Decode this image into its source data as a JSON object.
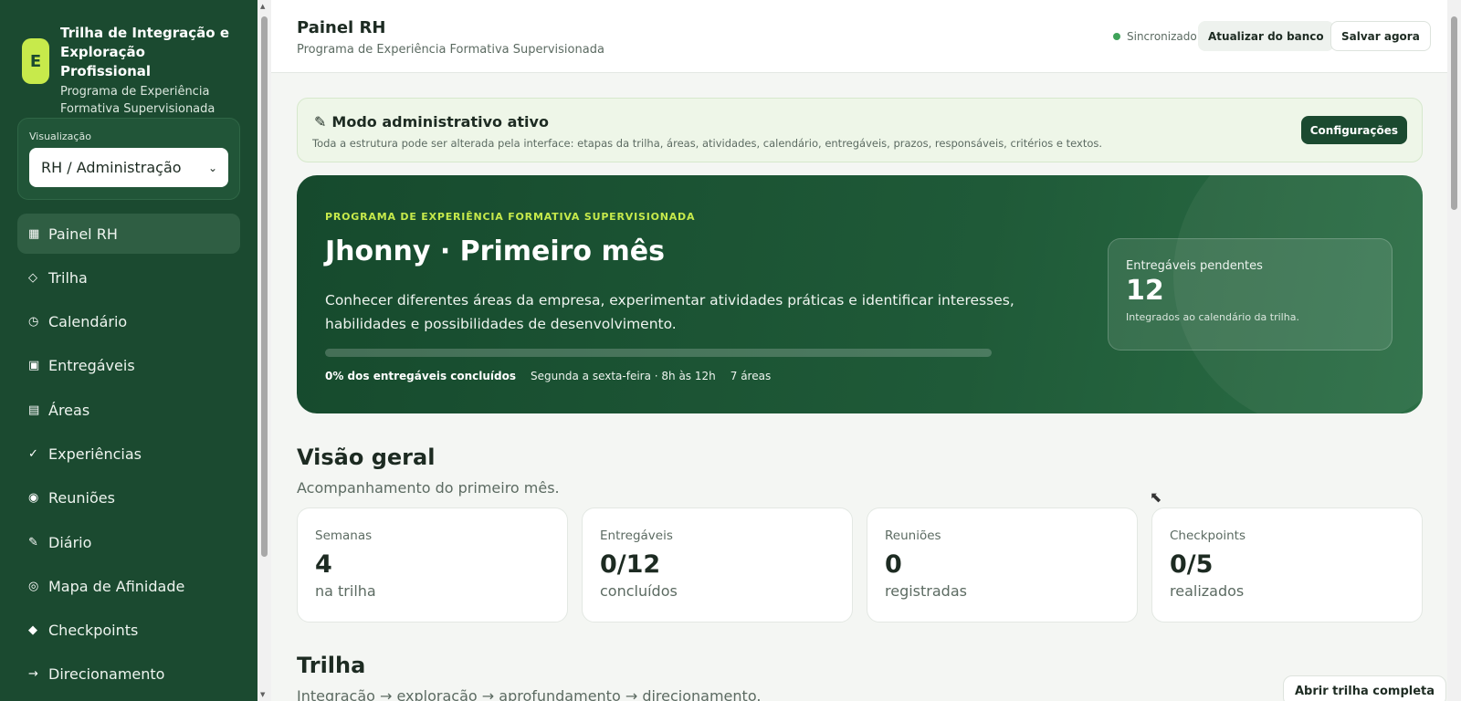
{
  "brand": {
    "logo_letter": "E",
    "title": "Trilha de Integração e Exploração Profissional",
    "subtitle": "Programa de Experiência Formativa Supervisionada"
  },
  "visualization": {
    "label": "Visualização",
    "selected": "RH / Administração"
  },
  "nav": [
    {
      "icon": "▦",
      "label": "Painel RH"
    },
    {
      "icon": "◇",
      "label": "Trilha"
    },
    {
      "icon": "◷",
      "label": "Calendário"
    },
    {
      "icon": "▣",
      "label": "Entregáveis"
    },
    {
      "icon": "▤",
      "label": "Áreas"
    },
    {
      "icon": "✓",
      "label": "Experiências"
    },
    {
      "icon": "◉",
      "label": "Reuniões"
    },
    {
      "icon": "✎",
      "label": "Diário"
    },
    {
      "icon": "◎",
      "label": "Mapa de Afinidade"
    },
    {
      "icon": "◆",
      "label": "Checkpoints"
    },
    {
      "icon": "→",
      "label": "Direcionamento"
    }
  ],
  "header": {
    "title": "Painel RH",
    "subtitle": "Programa de Experiência Formativa Supervisionada",
    "status": "Sincronizado",
    "update_label": "Atualizar do banco",
    "save_label": "Salvar agora"
  },
  "admin": {
    "title": "Modo administrativo ativo",
    "description": "Toda a estrutura pode ser alterada pela interface: etapas da trilha, áreas, atividades, calendário, entregáveis, prazos, responsáveis, critérios e textos.",
    "config_label": "Configurações"
  },
  "hero": {
    "eyebrow": "PROGRAMA DE EXPERIÊNCIA FORMATIVA SUPERVISIONADA",
    "title": "Jhonny · Primeiro mês",
    "description": "Conhecer diferentes áreas da empresa, experimentar atividades práticas e identificar interesses, habilidades e possibilidades de desenvolvimento.",
    "progress_fraction": 0,
    "progress_label": "0% dos entregáveis concluídos",
    "schedule": "Segunda a sexta-feira · 8h às 12h",
    "areas": "7 áreas",
    "pending_label": "Entregáveis pendentes",
    "pending_value": "12",
    "pending_note": "Integrados ao calendário da trilha."
  },
  "overview": {
    "title": "Visão geral",
    "subtitle": "Acompanhamento do primeiro mês.",
    "stats": [
      {
        "label": "Semanas",
        "value": "4",
        "unit": "na trilha"
      },
      {
        "label": "Entregáveis",
        "value": "0/12",
        "unit": "concluídos"
      },
      {
        "label": "Reuniões",
        "value": "0",
        "unit": "registradas"
      },
      {
        "label": "Checkpoints",
        "value": "0/5",
        "unit": "realizados"
      }
    ]
  },
  "trail": {
    "title": "Trilha",
    "subtitle": "Integração → exploração → aprofundamento → direcionamento.",
    "open_label": "Abrir trilha completa"
  }
}
